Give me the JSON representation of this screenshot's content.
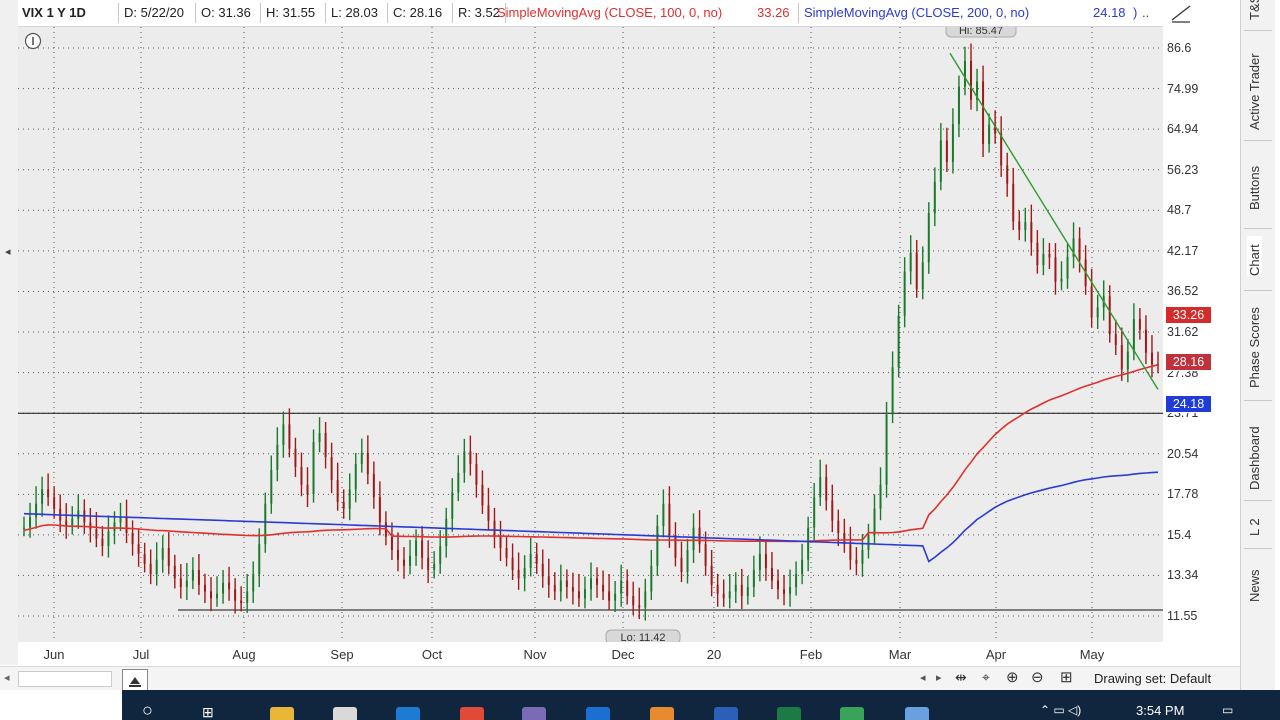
{
  "header": {
    "symbol": "VIX 1 Y 1D",
    "date": "D: 5/22/20",
    "open": "O: 31.36",
    "high": "H: 31.55",
    "low": "L: 28.03",
    "close": "C: 28.16",
    "range": "R: 3.52",
    "sma100_label": "SimpleMovingAvg (CLOSE, 100, 0, no)",
    "sma100_value": "33.26",
    "sma200_label": "SimpleMovingAvg (CLOSE, 200, 0, no)",
    "sma200_value": "24.18",
    "more": "..",
    "colors": {
      "sma100": "#e0302e",
      "sma200": "#2a3ad4"
    }
  },
  "chart_data": {
    "type": "candlestick",
    "title": "VIX 1 Y 1D",
    "y_ticks": [
      86.6,
      74.99,
      64.94,
      56.23,
      48.7,
      42.17,
      36.52,
      31.62,
      27.38,
      23.71,
      20.54,
      17.78,
      15.4,
      13.34,
      11.55
    ],
    "y_tick_labels": [
      "86.6",
      "74.99",
      "64.94",
      "56.23",
      "48.7",
      "42.17",
      "36.52",
      "31.62",
      "27.38",
      "23.71",
      "20.54",
      "17.78",
      "15.4",
      "13.34",
      "11.55"
    ],
    "scale": "log",
    "x_labels": [
      "Jun",
      "Jul",
      "Aug",
      "Sep",
      "Oct",
      "Nov",
      "Dec",
      "20",
      "Feb",
      "Mar",
      "Apr",
      "May"
    ],
    "high_annotation": "Hi: 85.47",
    "low_annotation": "Lo: 11.42",
    "close_series": [
      15.8,
      16.4,
      17.2,
      18.1,
      17.6,
      16.9,
      16.2,
      15.9,
      16.3,
      16.8,
      16.1,
      15.7,
      15.2,
      14.8,
      15.6,
      16.1,
      16.4,
      15.5,
      14.9,
      14.4,
      13.9,
      13.4,
      14.1,
      14.7,
      13.8,
      13.2,
      12.8,
      13.1,
      13.6,
      12.9,
      12.6,
      12.3,
      12.5,
      13.0,
      12.7,
      12.2,
      12.1,
      12.6,
      13.4,
      14.9,
      17.2,
      19.4,
      21.2,
      22.8,
      20.9,
      19.6,
      18.4,
      17.8,
      21.4,
      22.1,
      20.3,
      18.7,
      17.3,
      16.9,
      18.1,
      19.8,
      20.6,
      19.1,
      17.6,
      16.1,
      15.3,
      14.6,
      14.1,
      13.8,
      14.3,
      15.1,
      14.2,
      13.6,
      13.9,
      14.8,
      16.3,
      17.9,
      19.2,
      20.7,
      19.8,
      18.4,
      17.1,
      16.2,
      15.3,
      14.7,
      14.2,
      13.6,
      13.2,
      13.7,
      14.4,
      13.9,
      13.3,
      12.9,
      12.6,
      13.1,
      12.8,
      12.6,
      12.3,
      12.7,
      13.2,
      12.9,
      12.6,
      12.2,
      12.5,
      13.1,
      12.4,
      12.0,
      11.9,
      12.6,
      13.8,
      15.9,
      17.2,
      15.4,
      14.2,
      13.5,
      14.6,
      15.8,
      14.9,
      13.8,
      12.9,
      12.5,
      12.3,
      12.6,
      12.9,
      12.4,
      12.8,
      13.6,
      14.4,
      13.7,
      13.1,
      12.7,
      12.5,
      12.8,
      13.4,
      14.1,
      15.8,
      17.6,
      18.9,
      17.4,
      16.2,
      15.5,
      14.9,
      14.1,
      13.9,
      14.6,
      15.4,
      16.9,
      18.4,
      23.6,
      27.9,
      33.5,
      39.2,
      41.9,
      36.8,
      40.5,
      48.2,
      53.9,
      62.4,
      57.8,
      66.1,
      75.5,
      82.7,
      72.1,
      76.9,
      61.6,
      66.0,
      63.9,
      57.1,
      53.5,
      46.8,
      45.4,
      46.7,
      43.4,
      40.1,
      41.7,
      41.2,
      37.8,
      38.2,
      41.3,
      44.1,
      40.9,
      37.2,
      33.3,
      34.5,
      35.9,
      31.4,
      30.2,
      27.7,
      29.5,
      33.1,
      31.9,
      29.4,
      28.2,
      28.16
    ]
  },
  "price_badges": {
    "sma100": {
      "value": "33.26",
      "color": "#d62b2b"
    },
    "last": {
      "value": "28.16",
      "color": "#c0313b"
    },
    "sma200": {
      "value": "24.18",
      "color": "#1f3cd8"
    }
  },
  "right_tabs": [
    "T&S",
    "Active Trader",
    "Buttons",
    "Chart",
    "Phase Scores",
    "Dashboard",
    "L 2",
    "News"
  ],
  "bottom": {
    "drawing_set": "Drawing set: Default"
  },
  "taskbar": {
    "time": "3:54 PM"
  }
}
